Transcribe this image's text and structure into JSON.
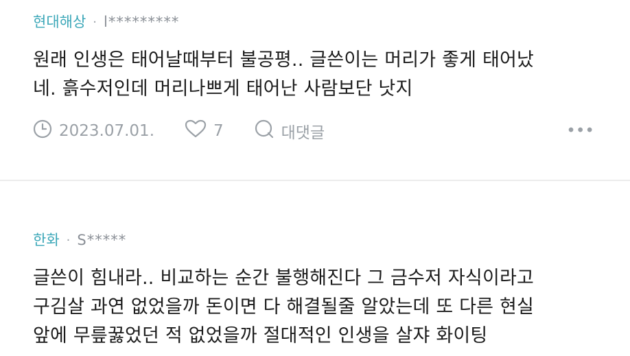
{
  "comments": [
    {
      "company": "현대해상",
      "separator": "·",
      "user": "l*********",
      "lines": [
        "원래 인생은 태어날때부터 불공평.. 글쓴이는 머리가 좋게 태어났",
        "네. 흙수저인데 머리나쁘게 태어난 사람보단 낫지"
      ],
      "date": "2023.07.01.",
      "likes": "7",
      "reply_label": "대댓글",
      "more": "•••"
    },
    {
      "company": "한화",
      "separator": "·",
      "user": "S*****",
      "lines": [
        "글쓴이 힘내라.. 비교하는 순간 불행해진다 그 금수저 자식이라고",
        "구김살 과연 없었을까 돈이면 다 해결될줄 알았는데 또 다른 현실",
        "앞에 무릎꿇었던 적 없었을까 절대적인 인생을 살쟈 화이팅"
      ]
    }
  ]
}
